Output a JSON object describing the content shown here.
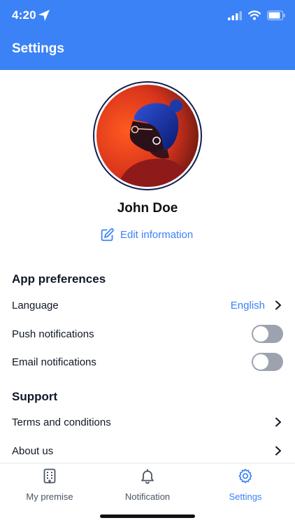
{
  "status_bar": {
    "time": "4:20"
  },
  "header": {
    "title": "Settings"
  },
  "profile": {
    "name": "John Doe",
    "edit_label": "Edit information"
  },
  "app_preferences": {
    "title": "App preferences",
    "language": {
      "label": "Language",
      "value": "English"
    },
    "push_notifications": {
      "label": "Push notifications",
      "enabled": false
    },
    "email_notifications": {
      "label": "Email notifications",
      "enabled": false
    }
  },
  "support": {
    "title": "Support",
    "terms": {
      "label": "Terms and conditions"
    },
    "about": {
      "label": "About us"
    }
  },
  "tabbar": {
    "items": [
      {
        "label": "My premise",
        "icon": "building-icon",
        "active": false
      },
      {
        "label": "Notification",
        "icon": "bell-icon",
        "active": false
      },
      {
        "label": "Settings",
        "icon": "gear-icon",
        "active": true
      }
    ]
  },
  "colors": {
    "accent": "#3b82f6",
    "toggle_off": "#9ca3af",
    "avatar_ring": "#0f1e52"
  }
}
